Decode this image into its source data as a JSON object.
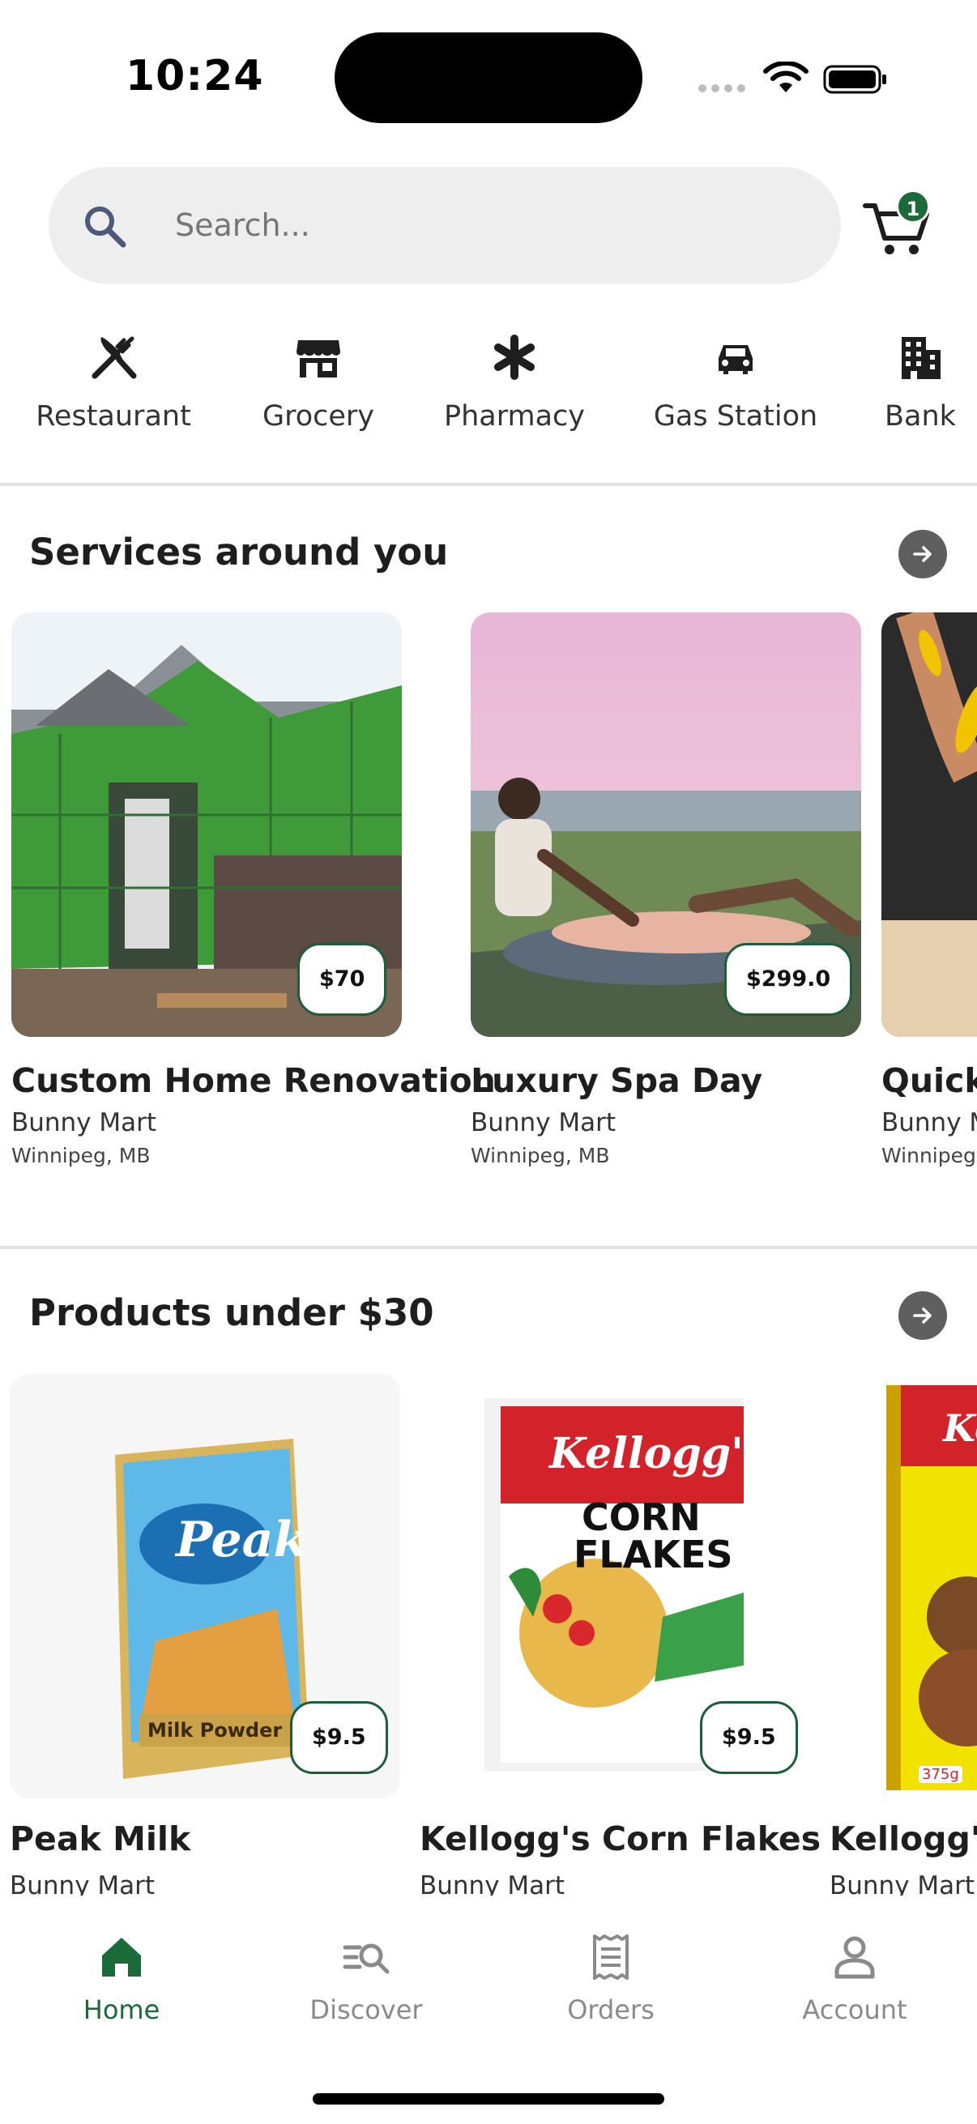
{
  "status_bar": {
    "time": "10:24"
  },
  "search": {
    "placeholder": "Search...",
    "cart_count": "1"
  },
  "categories": [
    {
      "label": "Restaurant",
      "icon": "fork-knife-icon"
    },
    {
      "label": "Grocery",
      "icon": "store-icon"
    },
    {
      "label": "Pharmacy",
      "icon": "asterisk-icon"
    },
    {
      "label": "Gas Station",
      "icon": "car-icon"
    },
    {
      "label": "Bank",
      "icon": "building-icon"
    }
  ],
  "services": {
    "title": "Services around you",
    "items": [
      {
        "title": "Custom Home Renovation",
        "store": "Bunny Mart",
        "location": "Winnipeg, MB",
        "price": "$70"
      },
      {
        "title": "Luxury Spa Day",
        "store": "Bunny Mart",
        "location": "Winnipeg, MB",
        "price": "$299.0"
      },
      {
        "title": "Quick",
        "store": "Bunny M",
        "location": "Winnipeg"
      }
    ]
  },
  "products": {
    "title": "Products under $30",
    "items": [
      {
        "title": "Peak Milk",
        "store": "Bunny Mart",
        "price": "$9.5",
        "package_brand": "Peak",
        "package_line": "Milk Powder"
      },
      {
        "title": "Kellogg's Corn Flakes",
        "store": "Bunny Mart",
        "price": "$9.5",
        "package_brand": "Kellogg's",
        "package_line1": "CORN",
        "package_line2": "FLAKES"
      },
      {
        "title": "Kellogg's",
        "store": "Bunny Mart",
        "package_brand": "Kel",
        "package_weight": "375g"
      }
    ]
  },
  "tabs": [
    {
      "label": "Home",
      "active": true
    },
    {
      "label": "Discover"
    },
    {
      "label": "Orders"
    },
    {
      "label": "Account"
    }
  ],
  "colors": {
    "accent": "#1b6b3a",
    "badge_border": "#1b5e3a",
    "inactive": "#8a8a8a"
  }
}
